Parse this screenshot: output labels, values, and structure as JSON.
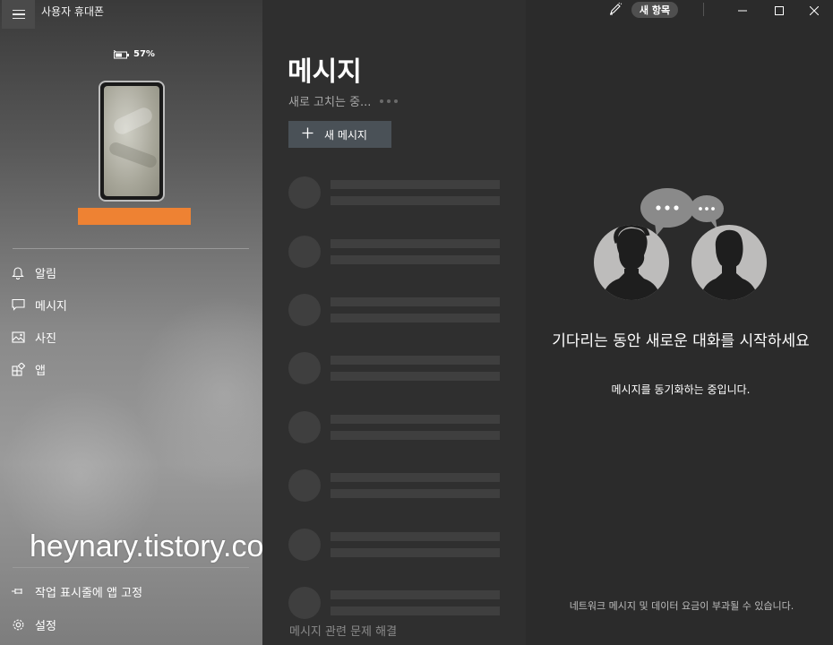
{
  "window": {
    "app_title": "사용자 휴대폰",
    "new_items_badge": "새 항목"
  },
  "phone": {
    "battery_percent": "57%",
    "name_bar_color": "#ee8233"
  },
  "sidebar": {
    "items": [
      {
        "label": "알림",
        "icon": "bell-icon"
      },
      {
        "label": "메시지",
        "icon": "chat-icon"
      },
      {
        "label": "사진",
        "icon": "photo-icon"
      },
      {
        "label": "앱",
        "icon": "apps-icon"
      }
    ],
    "bottom_items": [
      {
        "label": "작업 표시줄에 앱 고정",
        "icon": "pin-icon"
      },
      {
        "label": "설정",
        "icon": "gear-icon"
      }
    ]
  },
  "watermark": "heynary.tistory.com",
  "messages": {
    "title": "메시지",
    "refresh_status": "새로 고치는 중...",
    "new_message_label": "새 메시지",
    "troubleshoot_link": "메시지 관련 문제 해결"
  },
  "empty_state": {
    "title": "기다리는 동안 새로운 대화를 시작하세요",
    "subtitle": "메시지를 동기화하는 중입니다.",
    "footer_note": "네트워크 메시지 및 데이터 요금이 부과될 수 있습니다."
  },
  "colors": {
    "accent_orange": "#ee8233",
    "button_bg": "#4a5157",
    "pane_dark": "#2b2b2b"
  }
}
